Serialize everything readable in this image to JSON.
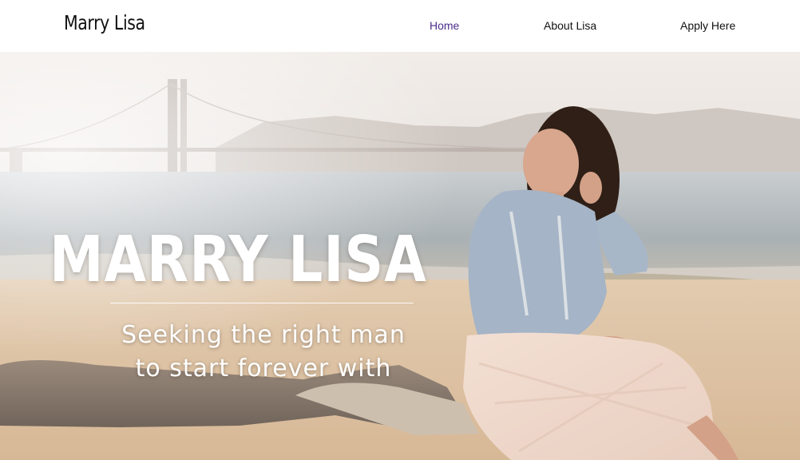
{
  "header": {
    "site_title": "Marry Lisa",
    "nav": {
      "home": "Home",
      "about": "About Lisa",
      "apply": "Apply Here"
    }
  },
  "hero": {
    "title": "MARRY LISA",
    "subtitle_line1": "Seeking the right man",
    "subtitle_line2": "to start forever with"
  },
  "colors": {
    "active_nav": "#4b2c8c",
    "text": "#111111",
    "hero_text": "#ffffff"
  }
}
